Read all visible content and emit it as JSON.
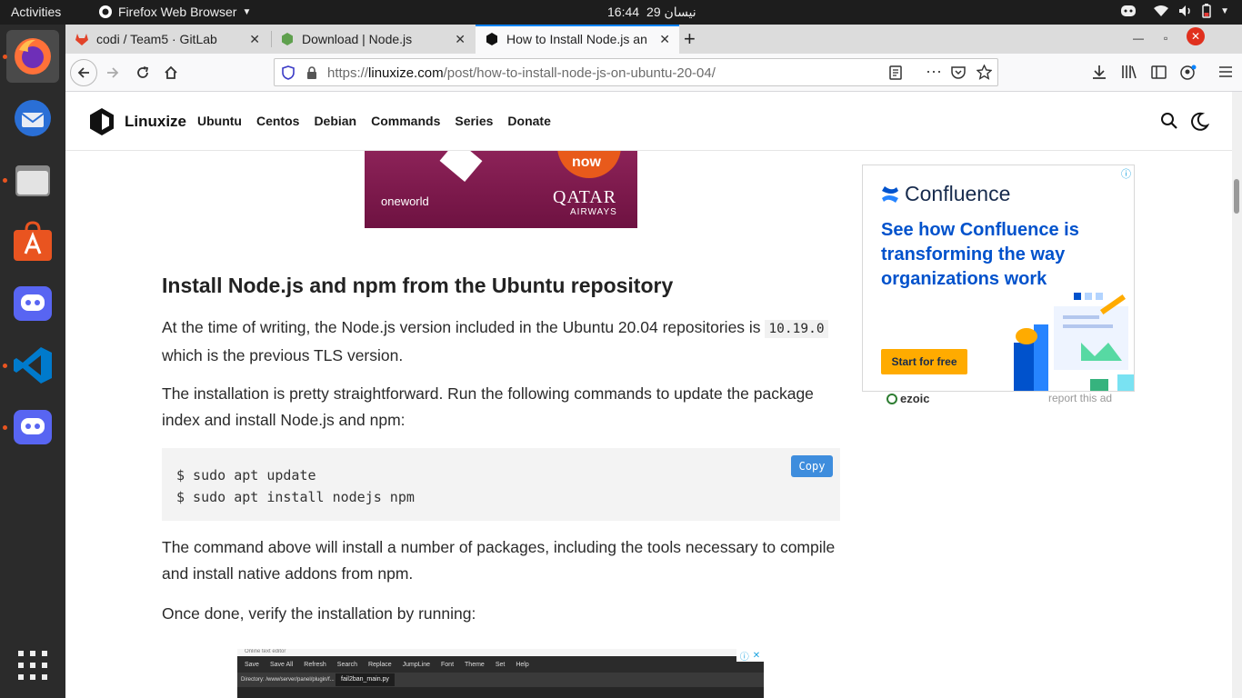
{
  "topbar": {
    "activities": "Activities",
    "app_name": "Firefox Web Browser",
    "clock_time": "16:44",
    "clock_date": "29 نيسان"
  },
  "dock": {
    "items": [
      "firefox",
      "thunderbird",
      "files",
      "software",
      "discord",
      "vscode",
      "discord"
    ]
  },
  "browser": {
    "tabs": [
      {
        "title": "codi / Team5 · GitLab",
        "icon": "gitlab-icon"
      },
      {
        "title": "Download | Node.js",
        "icon": "nodejs-icon"
      },
      {
        "title": "How to Install Node.js an",
        "icon": "linuxize-icon"
      }
    ],
    "url_prefix": "https://",
    "url_domain": "linuxize.com",
    "url_path": "/post/how-to-install-node-js-on-ubuntu-20-04/"
  },
  "site": {
    "logo": "Linuxize",
    "nav": [
      "Ubuntu",
      "Centos",
      "Debian",
      "Commands",
      "Series",
      "Donate"
    ]
  },
  "ad_top": {
    "oneworld": "oneworld",
    "qatar": "QATAR",
    "airways": "AIRWAYS",
    "badge": "now"
  },
  "article": {
    "heading": "Install Node.js and npm from the Ubuntu repository",
    "p1_a": "At the time of writing, the Node.js version included in the Ubuntu 20.04 repositories is",
    "p1_code": "10.19.0",
    "p1_b": " which is the previous TLS version.",
    "p2": "The installation is pretty straightforward. Run the following commands to update the package index and install Node.js and npm:",
    "code_lines": [
      "$ sudo apt update",
      "$ sudo apt install nodejs npm"
    ],
    "copy_label": "Copy",
    "p3": "The command above will install a number of packages, including the tools necessary to compile and install native addons from npm.",
    "p4": "Once done, verify the installation by running:"
  },
  "ad_editor": {
    "caption": "Online text editor",
    "toolbar": [
      "Save",
      "Save All",
      "Refresh",
      "Search",
      "Replace",
      "JumpLine",
      "Font",
      "Theme",
      "Set",
      "Help"
    ],
    "directory": "Directory: /www/server/panel/plugin/f...",
    "file_tab": "fail2ban_main.py"
  },
  "ad_side": {
    "brand": "Confluence",
    "headline": "See how Confluence is transforming the way organizations work",
    "cta": "Start for free",
    "ezoic": "ezoic",
    "report": "report this ad"
  }
}
